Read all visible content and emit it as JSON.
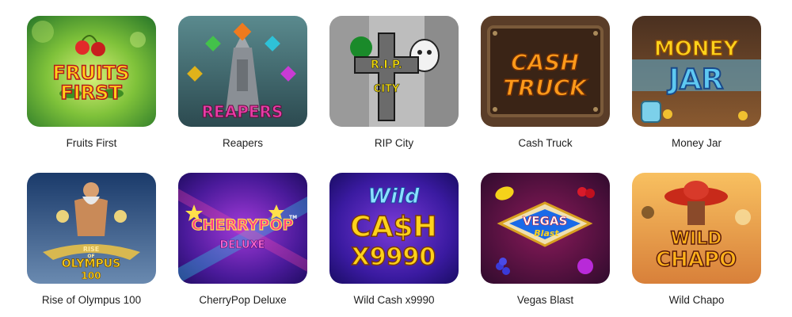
{
  "games": [
    {
      "title": "Fruits First",
      "logo": [
        "FRUITS",
        "FIRST"
      ]
    },
    {
      "title": "Reapers",
      "logo": [
        "REAPERS"
      ]
    },
    {
      "title": "RIP City",
      "logo": [
        "R.I.P.",
        "CITY"
      ]
    },
    {
      "title": "Cash Truck",
      "logo": [
        "CASH",
        "TRUCK"
      ]
    },
    {
      "title": "Money Jar",
      "logo": [
        "MONEY",
        "JAR"
      ]
    },
    {
      "title": "Rise of Olympus 100",
      "logo": [
        "RISE",
        "OF",
        "OLYMPUS",
        "100"
      ]
    },
    {
      "title": "CherryPop Deluxe",
      "logo": [
        "CHERRYPOP",
        "DELUXE",
        "TM"
      ]
    },
    {
      "title": "Wild Cash x9990",
      "logo": [
        "Wild",
        "CA$H",
        "X9990"
      ]
    },
    {
      "title": "Vegas Blast",
      "logo": [
        "VEGAS",
        "Blast"
      ]
    },
    {
      "title": "Wild Chapo",
      "logo": [
        "WILD",
        "CHAPO"
      ]
    }
  ],
  "colors": {
    "label_text": "#222222",
    "background": "#ffffff"
  }
}
